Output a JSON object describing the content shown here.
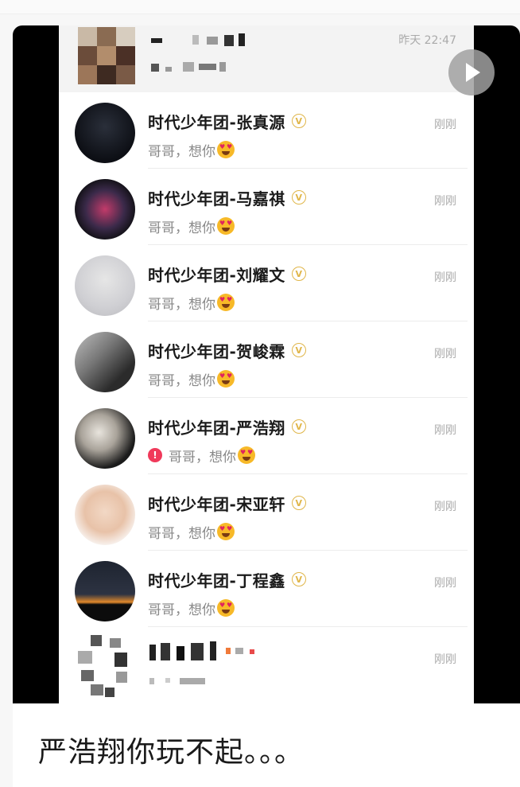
{
  "header": {
    "time": "昨天 22:47"
  },
  "chat_list": [
    {
      "name": "时代少年团-张真源",
      "message": "哥哥，想你",
      "time": "刚刚",
      "warning": false,
      "avatar": "concert-stage"
    },
    {
      "name": "时代少年团-马嘉祺",
      "message": "哥哥，想你",
      "time": "刚刚",
      "warning": false,
      "avatar": "heart-logo"
    },
    {
      "name": "时代少年团-刘耀文",
      "message": "哥哥，想你",
      "time": "刚刚",
      "warning": false,
      "avatar": "silhouette"
    },
    {
      "name": "时代少年团-贺峻霖",
      "message": "哥哥，想你",
      "time": "刚刚",
      "warning": false,
      "avatar": "dark-portrait"
    },
    {
      "name": "时代少年团-严浩翔",
      "message": "哥哥，想你",
      "time": "刚刚",
      "warning": true,
      "avatar": "lace-cap"
    },
    {
      "name": "时代少年团-宋亚轩",
      "message": "哥哥，想你",
      "time": "刚刚",
      "warning": false,
      "avatar": "boy-portrait"
    },
    {
      "name": "时代少年团-丁程鑫",
      "message": "哥哥，想你",
      "time": "刚刚",
      "warning": false,
      "avatar": "sunset"
    }
  ],
  "footer_row": {
    "time": "刚刚"
  },
  "caption": {
    "text": "严浩翔你玩不起。。。"
  },
  "icons": {
    "verified": "verified-badge-icon",
    "emoji": "heart-eyes-emoji-icon",
    "warning": "failed-send-icon",
    "play": "play-icon"
  },
  "colors": {
    "verified": "#e0b64a",
    "warning": "#f0395a",
    "emoji": "#f7b928"
  }
}
